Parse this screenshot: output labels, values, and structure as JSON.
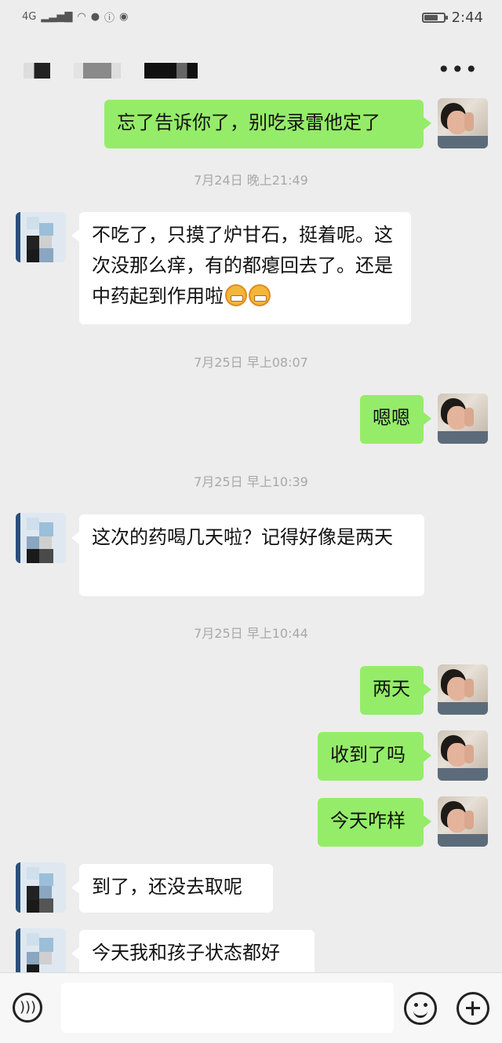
{
  "status_bar": {
    "network": "4G",
    "time": "2:44",
    "battery_level": 0.7
  },
  "header": {
    "title_blurred": true,
    "more_icon": "more-dots-icon"
  },
  "messages": [
    {
      "type": "message",
      "from": "self",
      "text": "忘了告诉你了，别吃录雷他定了"
    },
    {
      "type": "timestamp",
      "text": "7月24日 晚上21:49"
    },
    {
      "type": "message",
      "from": "other",
      "text": "不吃了，只摸了炉甘石，挺着呢。这次没那么痒，有的都瘪回去了。还是中药起到作用啦",
      "emoji": [
        "grin-emoji",
        "grin-emoji"
      ]
    },
    {
      "type": "timestamp",
      "text": "7月25日 早上08:07"
    },
    {
      "type": "message",
      "from": "self",
      "text": "嗯嗯"
    },
    {
      "type": "timestamp",
      "text": "7月25日 早上10:39"
    },
    {
      "type": "message",
      "from": "other",
      "text": "这次的药喝几天啦？记得好像是两天"
    },
    {
      "type": "timestamp",
      "text": "7月25日 早上10:44"
    },
    {
      "type": "message",
      "from": "self",
      "text": "两天"
    },
    {
      "type": "message",
      "from": "self",
      "text": "收到了吗"
    },
    {
      "type": "message",
      "from": "self",
      "text": "今天咋样"
    },
    {
      "type": "message",
      "from": "other",
      "text": "到了，还没去取呢"
    },
    {
      "type": "message",
      "from": "other",
      "text": "今天我和孩子状态都好"
    }
  ],
  "input_bar": {
    "voice_icon": "voice-icon",
    "input_value": "",
    "emoji_icon": "emoji-icon",
    "plus_icon": "plus-icon"
  }
}
